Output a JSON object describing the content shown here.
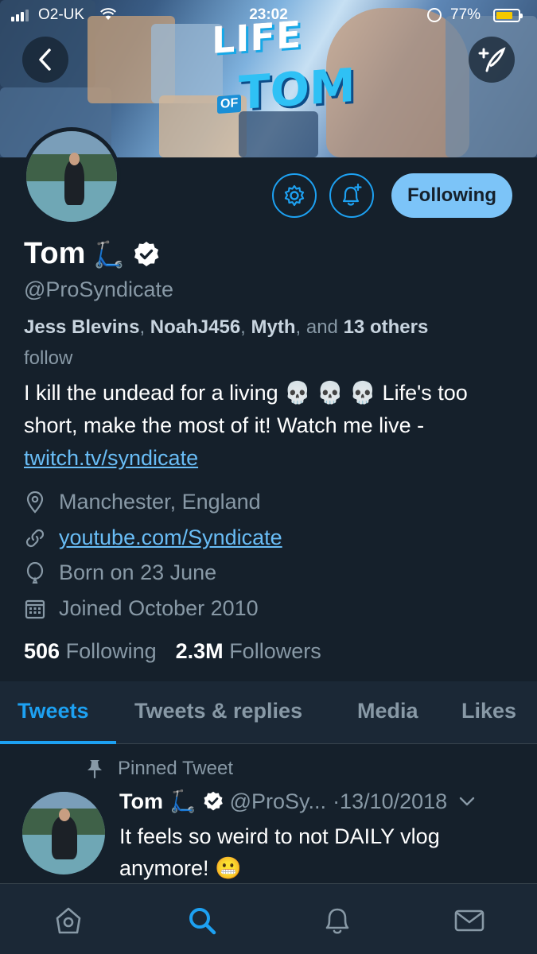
{
  "status_bar": {
    "carrier": "O2-UK",
    "time": "23:02",
    "battery_percent": "77%",
    "battery_level": 0.77,
    "battery_color": "#f5c800"
  },
  "banner": {
    "logo_line1": "LIFE",
    "logo_line2": "OF",
    "logo_line3": "TOM",
    "back_icon": "chevron-left-icon",
    "compose_icon": "compose-tweet-icon"
  },
  "profile": {
    "name": "Tom",
    "name_emoji": "🛴",
    "verified": true,
    "handle": "@ProSyndicate",
    "follow_button_label": "Following",
    "followed_by": {
      "name1": "Jess Blevins",
      "sep1": ", ",
      "name2": "NoahJ456",
      "sep2": ", ",
      "name3": "Myth",
      "sep3": ", and ",
      "count": "13",
      "others": "others",
      "suffix": " follow"
    },
    "bio": {
      "text1": "I kill the undead for a living 💀 💀 💀 Life's too short, make the most of it! Watch me live - ",
      "link": "twitch.tv/syndicate"
    },
    "location": "Manchester, England",
    "website": "youtube.com/Syndicate",
    "birthday": "Born on 23 June",
    "joined": "Joined October 2010",
    "following_count": "506",
    "following_label": "Following",
    "followers_count": "2.3M",
    "followers_label": "Followers"
  },
  "tabs": [
    {
      "label": "Tweets",
      "active": true
    },
    {
      "label": "Tweets & replies",
      "active": false
    },
    {
      "label": "Media",
      "active": false
    },
    {
      "label": "Likes",
      "active": false
    }
  ],
  "pinned_tweet": {
    "pinned_label": "Pinned Tweet",
    "author_name": "Tom",
    "author_emoji": "🛴",
    "author_handle": "@ProSy...",
    "date": "·13/10/2018",
    "text": "It feels so weird to not DAILY vlog anymore! 😬"
  },
  "colors": {
    "background": "#15202b",
    "accent": "#1da1f2",
    "secondary_text": "#8899a6",
    "link": "#69bdf6"
  }
}
